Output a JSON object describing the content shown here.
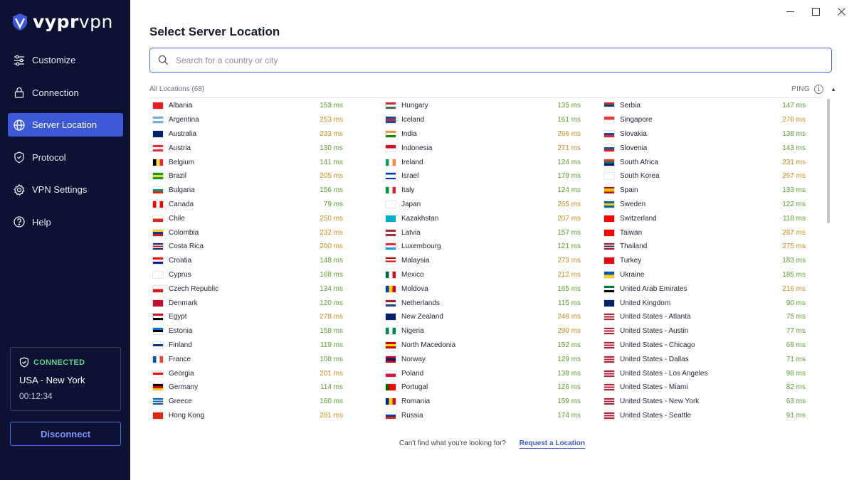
{
  "app": {
    "brand_bold": "vypr",
    "brand_light": "vpn"
  },
  "colors": {
    "ping_good": "#5aa02c",
    "ping_medium": "#d08c1c",
    "accent": "#3d59d6",
    "connected": "#5fd38d"
  },
  "sidebar": {
    "items": [
      {
        "label": "Customize",
        "icon": "sliders-icon"
      },
      {
        "label": "Connection",
        "icon": "lock-icon"
      },
      {
        "label": "Server Location",
        "icon": "globe-icon",
        "active": true
      },
      {
        "label": "Protocol",
        "icon": "shield-icon"
      },
      {
        "label": "VPN Settings",
        "icon": "gear-icon"
      },
      {
        "label": "Help",
        "icon": "help-icon"
      }
    ],
    "status": {
      "label": "CONNECTED",
      "location": "USA - New York",
      "time": "00:12:34"
    },
    "disconnect_label": "Disconnect"
  },
  "main": {
    "title": "Select Server Location",
    "search_placeholder": "Search for a country or city",
    "list_label": "All Locations (68)",
    "ping_label": "PING",
    "footer_text": "Can't find what you're looking for?",
    "footer_link": "Request a Location"
  },
  "locations": [
    [
      {
        "name": "Albania",
        "ping": "153 ms",
        "flag": [
          "#e41e20",
          "#e41e20"
        ]
      },
      {
        "name": "Argentina",
        "ping": "253 ms",
        "flag": [
          "#74acdf",
          "#ffffff",
          "#74acdf"
        ]
      },
      {
        "name": "Australia",
        "ping": "233 ms",
        "flag": [
          "#012169",
          "#012169"
        ]
      },
      {
        "name": "Austria",
        "ping": "130 ms",
        "flag": [
          "#ed2939",
          "#ffffff",
          "#ed2939"
        ]
      },
      {
        "name": "Belgium",
        "ping": "141 ms",
        "flag": [
          "#000000",
          "#fae042",
          "#ed2939"
        ],
        "v": true
      },
      {
        "name": "Brazil",
        "ping": "205 ms",
        "flag": [
          "#009c3b",
          "#ffdf00",
          "#009c3b"
        ]
      },
      {
        "name": "Bulgaria",
        "ping": "156 ms",
        "flag": [
          "#ffffff",
          "#00966e",
          "#d62612"
        ]
      },
      {
        "name": "Canada",
        "ping": "79 ms",
        "flag": [
          "#ff0000",
          "#ffffff",
          "#ff0000"
        ],
        "v": true
      },
      {
        "name": "Chile",
        "ping": "250 ms",
        "flag": [
          "#ffffff",
          "#d52b1e"
        ]
      },
      {
        "name": "Colombia",
        "ping": "232 ms",
        "flag": [
          "#fcd116",
          "#003893",
          "#ce1126"
        ]
      },
      {
        "name": "Costa Rica",
        "ping": "200 ms",
        "flag": [
          "#002b7f",
          "#ffffff",
          "#ce1126",
          "#ffffff",
          "#002b7f"
        ]
      },
      {
        "name": "Croatia",
        "ping": "148 ms",
        "flag": [
          "#ff0000",
          "#ffffff",
          "#171796"
        ]
      },
      {
        "name": "Cyprus",
        "ping": "168 ms",
        "flag": [
          "#ffffff",
          "#ffffff"
        ]
      },
      {
        "name": "Czech Republic",
        "ping": "134 ms",
        "flag": [
          "#ffffff",
          "#d7141a"
        ]
      },
      {
        "name": "Denmark",
        "ping": "120 ms",
        "flag": [
          "#c60c30",
          "#c60c30"
        ]
      },
      {
        "name": "Egypt",
        "ping": "278 ms",
        "flag": [
          "#ce1126",
          "#ffffff",
          "#000000"
        ]
      },
      {
        "name": "Estonia",
        "ping": "158 ms",
        "flag": [
          "#0072ce",
          "#000000",
          "#ffffff"
        ]
      },
      {
        "name": "Finland",
        "ping": "119 ms",
        "flag": [
          "#ffffff",
          "#003580",
          "#ffffff"
        ]
      },
      {
        "name": "France",
        "ping": "108 ms",
        "flag": [
          "#0055a4",
          "#ffffff",
          "#ef4135"
        ],
        "v": true
      },
      {
        "name": "Georgia",
        "ping": "201 ms",
        "flag": [
          "#ffffff",
          "#ff0000",
          "#ffffff"
        ]
      },
      {
        "name": "Germany",
        "ping": "114 ms",
        "flag": [
          "#000000",
          "#dd0000",
          "#ffce00"
        ]
      },
      {
        "name": "Greece",
        "ping": "160 ms",
        "flag": [
          "#0d5eaf",
          "#ffffff",
          "#0d5eaf",
          "#ffffff",
          "#0d5eaf"
        ]
      },
      {
        "name": "Hong Kong",
        "ping": "281 ms",
        "flag": [
          "#de2910",
          "#de2910"
        ]
      }
    ],
    [
      {
        "name": "Hungary",
        "ping": "135 ms",
        "flag": [
          "#ce2939",
          "#ffffff",
          "#477050"
        ]
      },
      {
        "name": "Iceland",
        "ping": "161 ms",
        "flag": [
          "#02529c",
          "#dc1e35",
          "#02529c"
        ]
      },
      {
        "name": "India",
        "ping": "266 ms",
        "flag": [
          "#ff9933",
          "#ffffff",
          "#138808"
        ]
      },
      {
        "name": "Indonesia",
        "ping": "271 ms",
        "flag": [
          "#ce1126",
          "#ffffff"
        ]
      },
      {
        "name": "Ireland",
        "ping": "124 ms",
        "flag": [
          "#169b62",
          "#ffffff",
          "#ff883e"
        ],
        "v": true
      },
      {
        "name": "Israel",
        "ping": "179 ms",
        "flag": [
          "#0038b8",
          "#ffffff",
          "#ffffff",
          "#0038b8"
        ]
      },
      {
        "name": "Italy",
        "ping": "124 ms",
        "flag": [
          "#009246",
          "#ffffff",
          "#ce2b37"
        ],
        "v": true
      },
      {
        "name": "Japan",
        "ping": "265 ms",
        "flag": [
          "#ffffff",
          "#ffffff"
        ]
      },
      {
        "name": "Kazakhstan",
        "ping": "207 ms",
        "flag": [
          "#00afca",
          "#00afca"
        ]
      },
      {
        "name": "Latvia",
        "ping": "157 ms",
        "flag": [
          "#9e3039",
          "#ffffff",
          "#9e3039"
        ]
      },
      {
        "name": "Luxembourg",
        "ping": "121 ms",
        "flag": [
          "#ed2939",
          "#ffffff",
          "#00a1de"
        ]
      },
      {
        "name": "Malaysia",
        "ping": "273 ms",
        "flag": [
          "#cc0001",
          "#ffffff",
          "#cc0001",
          "#ffffff"
        ]
      },
      {
        "name": "Mexico",
        "ping": "212 ms",
        "flag": [
          "#006847",
          "#ffffff",
          "#ce1126"
        ],
        "v": true
      },
      {
        "name": "Moldova",
        "ping": "165 ms",
        "flag": [
          "#003da5",
          "#ffd200",
          "#cc092f"
        ],
        "v": true
      },
      {
        "name": "Netherlands",
        "ping": "115 ms",
        "flag": [
          "#ae1c28",
          "#ffffff",
          "#21468b"
        ]
      },
      {
        "name": "New Zealand",
        "ping": "248 ms",
        "flag": [
          "#012169",
          "#012169"
        ]
      },
      {
        "name": "Nigeria",
        "ping": "290 ms",
        "flag": [
          "#008751",
          "#ffffff",
          "#008751"
        ],
        "v": true
      },
      {
        "name": "North Macedonia",
        "ping": "152 ms",
        "flag": [
          "#d20000",
          "#ffe600",
          "#d20000"
        ]
      },
      {
        "name": "Norway",
        "ping": "129 ms",
        "flag": [
          "#ba0c2f",
          "#00205b",
          "#ba0c2f"
        ]
      },
      {
        "name": "Poland",
        "ping": "139 ms",
        "flag": [
          "#ffffff",
          "#dc143c"
        ]
      },
      {
        "name": "Portugal",
        "ping": "126 ms",
        "flag": [
          "#006600",
          "#ff0000",
          "#ff0000"
        ],
        "v": true
      },
      {
        "name": "Romania",
        "ping": "159 ms",
        "flag": [
          "#002b7f",
          "#fcd116",
          "#ce1126"
        ],
        "v": true
      },
      {
        "name": "Russia",
        "ping": "174 ms",
        "flag": [
          "#ffffff",
          "#0039a6",
          "#d52b1e"
        ]
      }
    ],
    [
      {
        "name": "Serbia",
        "ping": "147 ms",
        "flag": [
          "#c6363c",
          "#0c4076",
          "#ffffff"
        ]
      },
      {
        "name": "Singapore",
        "ping": "276 ms",
        "flag": [
          "#ef3340",
          "#ffffff"
        ]
      },
      {
        "name": "Slovakia",
        "ping": "138 ms",
        "flag": [
          "#ffffff",
          "#0b4ea2",
          "#ee1c25"
        ]
      },
      {
        "name": "Slovenia",
        "ping": "143 ms",
        "flag": [
          "#ffffff",
          "#005da4",
          "#ed1c24"
        ]
      },
      {
        "name": "South Africa",
        "ping": "231 ms",
        "flag": [
          "#e03c31",
          "#007749",
          "#001489"
        ]
      },
      {
        "name": "South Korea",
        "ping": "267 ms",
        "flag": [
          "#ffffff",
          "#ffffff"
        ]
      },
      {
        "name": "Spain",
        "ping": "133 ms",
        "flag": [
          "#aa151b",
          "#f1bf00",
          "#f1bf00",
          "#aa151b"
        ]
      },
      {
        "name": "Sweden",
        "ping": "122 ms",
        "flag": [
          "#006aa7",
          "#fecc00",
          "#006aa7"
        ]
      },
      {
        "name": "Switzerland",
        "ping": "118 ms",
        "flag": [
          "#ff0000",
          "#ff0000"
        ]
      },
      {
        "name": "Taiwan",
        "ping": "287 ms",
        "flag": [
          "#fe0000",
          "#fe0000"
        ]
      },
      {
        "name": "Thailand",
        "ping": "275 ms",
        "flag": [
          "#a51931",
          "#ffffff",
          "#2d2a4a",
          "#ffffff",
          "#a51931"
        ]
      },
      {
        "name": "Turkey",
        "ping": "183 ms",
        "flag": [
          "#e30a17",
          "#e30a17"
        ]
      },
      {
        "name": "Ukraine",
        "ping": "185 ms",
        "flag": [
          "#0057b7",
          "#ffd700"
        ]
      },
      {
        "name": "United Arab Emirates",
        "ping": "216 ms",
        "flag": [
          "#00732f",
          "#ffffff",
          "#000000"
        ]
      },
      {
        "name": "United Kingdom",
        "ping": "90 ms",
        "flag": [
          "#012169",
          "#012169"
        ]
      },
      {
        "name": "United States - Atlanta",
        "ping": "75 ms",
        "flag": [
          "#b22234",
          "#ffffff",
          "#b22234",
          "#ffffff",
          "#b22234"
        ]
      },
      {
        "name": "United States - Austin",
        "ping": "77 ms",
        "flag": [
          "#b22234",
          "#ffffff",
          "#b22234",
          "#ffffff",
          "#b22234"
        ]
      },
      {
        "name": "United States - Chicago",
        "ping": "69 ms",
        "flag": [
          "#b22234",
          "#ffffff",
          "#b22234",
          "#ffffff",
          "#b22234"
        ]
      },
      {
        "name": "United States - Dallas",
        "ping": "71 ms",
        "flag": [
          "#b22234",
          "#ffffff",
          "#b22234",
          "#ffffff",
          "#b22234"
        ]
      },
      {
        "name": "United States - Los Angeles",
        "ping": "98 ms",
        "flag": [
          "#b22234",
          "#ffffff",
          "#b22234",
          "#ffffff",
          "#b22234"
        ]
      },
      {
        "name": "United States - Miami",
        "ping": "82 ms",
        "flag": [
          "#b22234",
          "#ffffff",
          "#b22234",
          "#ffffff",
          "#b22234"
        ]
      },
      {
        "name": "United States - New York",
        "ping": "63 ms",
        "flag": [
          "#b22234",
          "#ffffff",
          "#b22234",
          "#ffffff",
          "#b22234"
        ]
      },
      {
        "name": "United States - Seattle",
        "ping": "91 ms",
        "flag": [
          "#b22234",
          "#ffffff",
          "#b22234",
          "#ffffff",
          "#b22234"
        ]
      }
    ]
  ]
}
